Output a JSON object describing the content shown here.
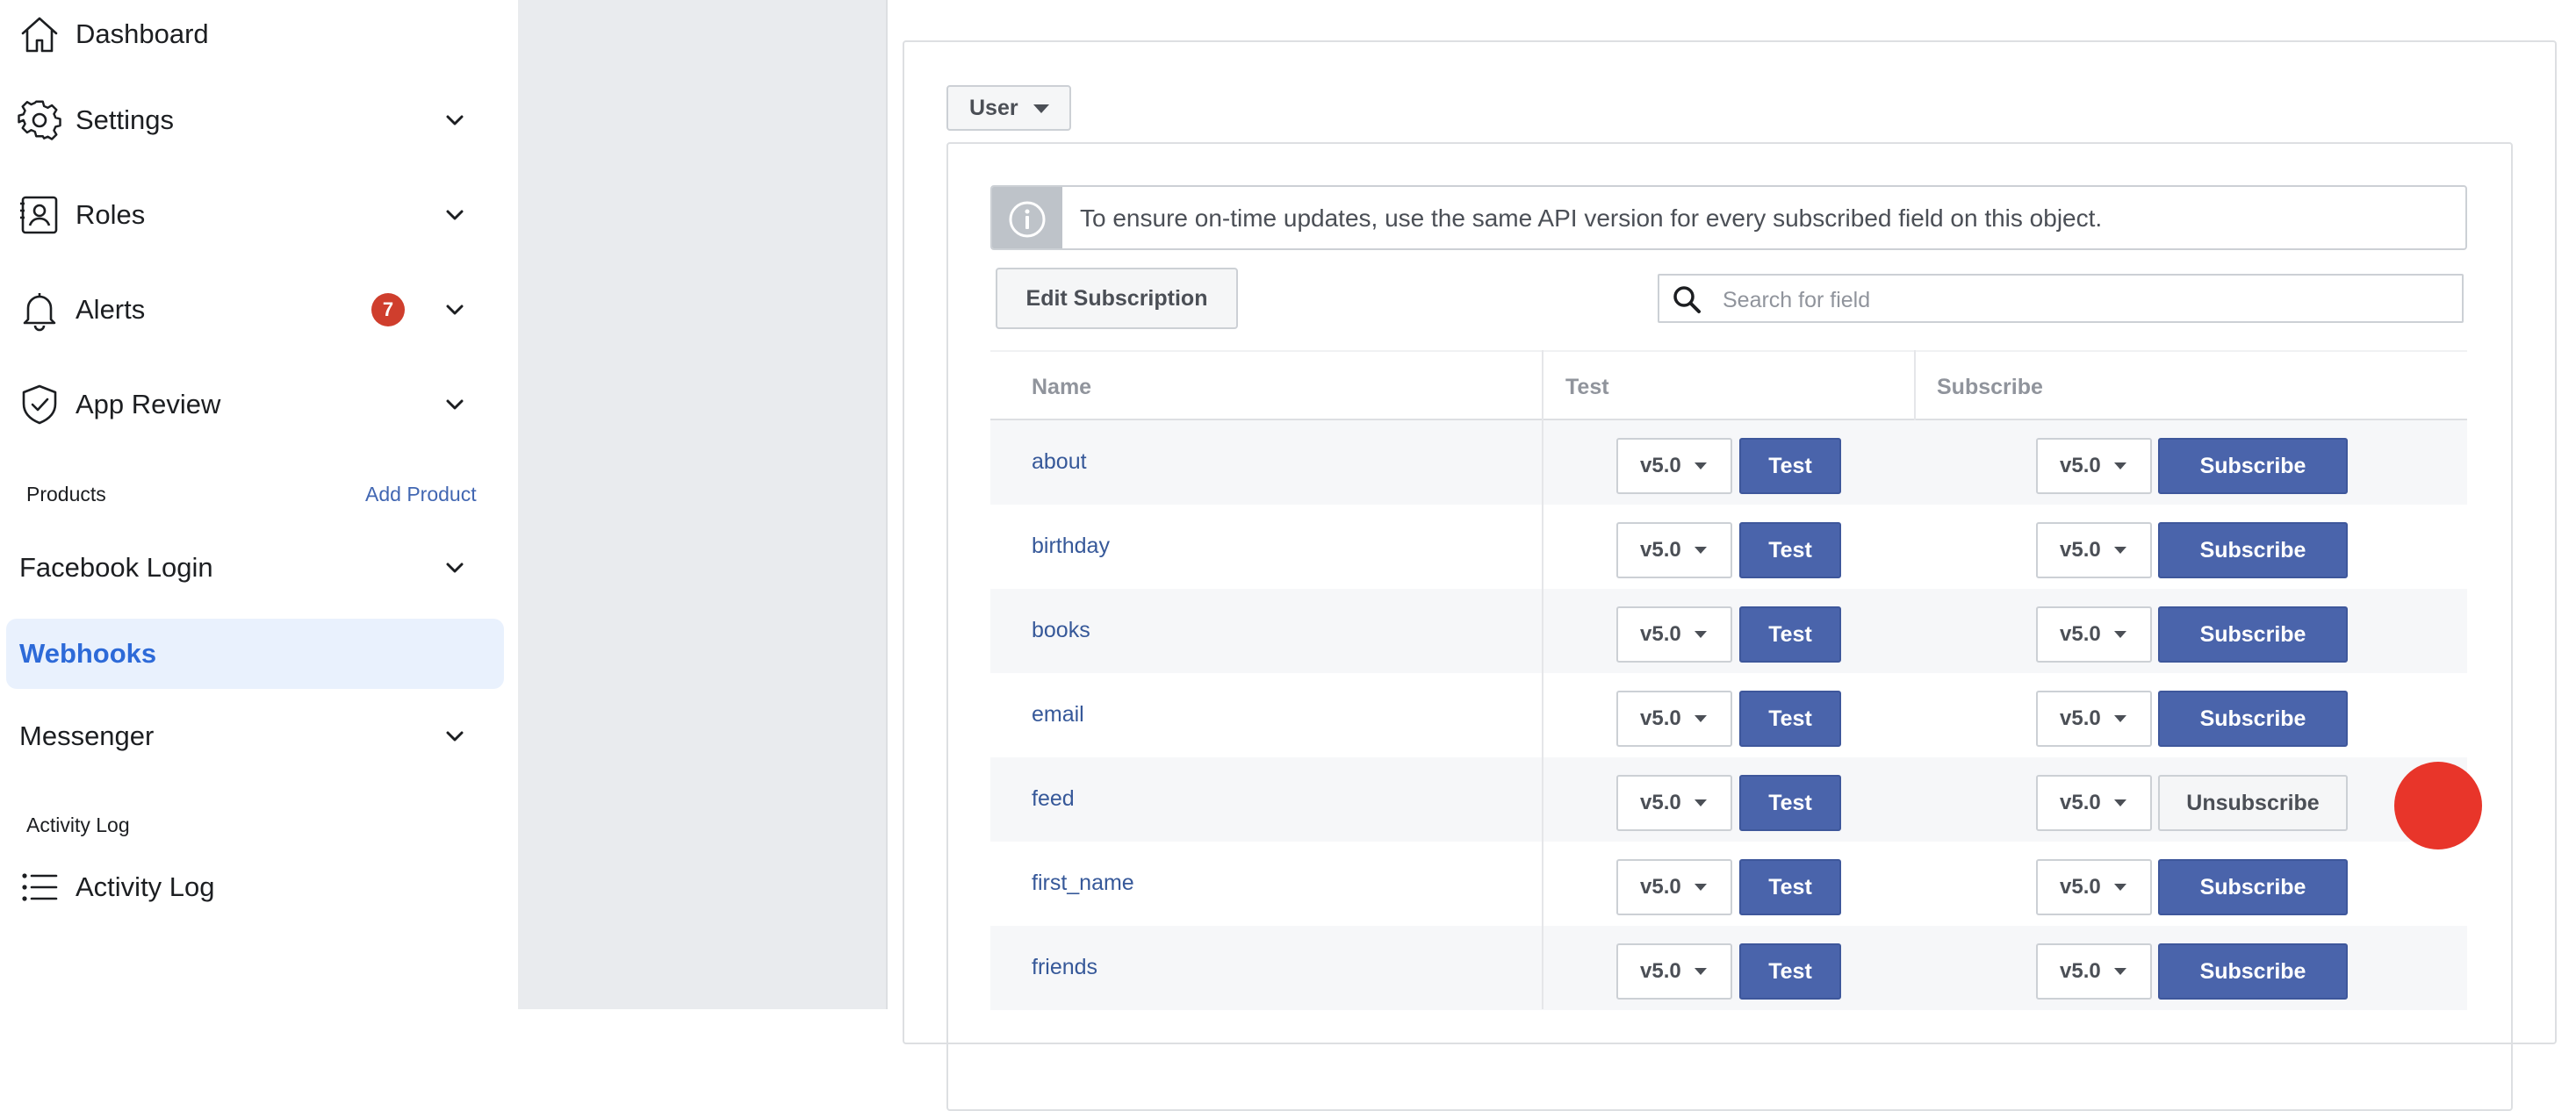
{
  "sidebar": {
    "items": [
      {
        "label": "Dashboard",
        "icon": "home-icon"
      },
      {
        "label": "Settings",
        "icon": "gear-icon"
      },
      {
        "label": "Roles",
        "icon": "id-badge-icon"
      },
      {
        "label": "Alerts",
        "icon": "bell-icon",
        "badge": "7"
      },
      {
        "label": "App Review",
        "icon": "shield-check-icon"
      }
    ],
    "products_heading": "Products",
    "add_product": "Add Product",
    "products": [
      {
        "label": "Facebook Login"
      },
      {
        "label": "Webhooks",
        "active": true
      },
      {
        "label": "Messenger"
      }
    ],
    "activity_heading": "Activity Log",
    "activity_item": {
      "label": "Activity Log",
      "icon": "list-icon"
    }
  },
  "panel": {
    "object_select": "User",
    "notice": "To ensure on-time updates, use the same API version for every subscribed field on this object.",
    "edit_subscription": "Edit Subscription",
    "search_placeholder": "Search for field",
    "columns": [
      "Name",
      "Test",
      "Subscribe"
    ],
    "rows": [
      {
        "name": "about",
        "test_version": "v5.0",
        "test_label": "Test",
        "sub_version": "v5.0",
        "sub_label": "Subscribe",
        "subscribed": false
      },
      {
        "name": "birthday",
        "test_version": "v5.0",
        "test_label": "Test",
        "sub_version": "v5.0",
        "sub_label": "Subscribe",
        "subscribed": false
      },
      {
        "name": "books",
        "test_version": "v5.0",
        "test_label": "Test",
        "sub_version": "v5.0",
        "sub_label": "Subscribe",
        "subscribed": false
      },
      {
        "name": "email",
        "test_version": "v5.0",
        "test_label": "Test",
        "sub_version": "v5.0",
        "sub_label": "Subscribe",
        "subscribed": false
      },
      {
        "name": "feed",
        "test_version": "v5.0",
        "test_label": "Test",
        "sub_version": "v5.0",
        "sub_label": "Unsubscribe",
        "subscribed": true
      },
      {
        "name": "first_name",
        "test_version": "v5.0",
        "test_label": "Test",
        "sub_version": "v5.0",
        "sub_label": "Subscribe",
        "subscribed": false
      },
      {
        "name": "friends",
        "test_version": "v5.0",
        "test_label": "Test",
        "sub_version": "v5.0",
        "sub_label": "Subscribe",
        "subscribed": false
      }
    ]
  },
  "colors": {
    "accent_blue": "#4a64ab",
    "active_nav_bg": "#e9f1fd",
    "active_nav_text": "#2d6ad8",
    "badge_red": "#cf3e2d",
    "cursor_marker": "#e8352a"
  }
}
